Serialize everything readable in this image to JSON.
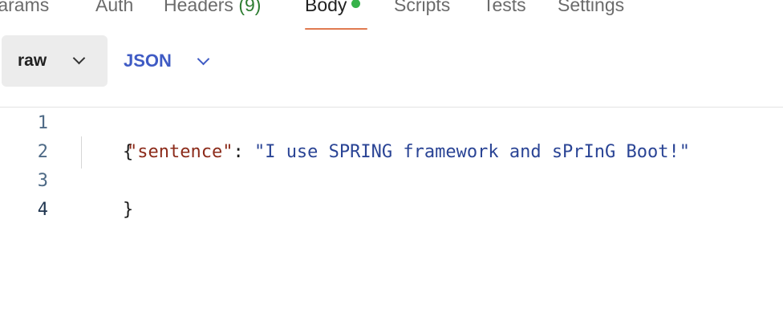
{
  "tabs": [
    {
      "label": "Params"
    },
    {
      "label": "Auth"
    },
    {
      "label": "Headers",
      "count": "(9)"
    },
    {
      "label": "Body"
    },
    {
      "label": "Scripts"
    },
    {
      "label": "Tests"
    },
    {
      "label": "Settings"
    }
  ],
  "active_tab": "Body",
  "toolbar": {
    "body_type": "raw",
    "format": "JSON"
  },
  "editor": {
    "line_numbers": [
      "1",
      "2",
      "3",
      "4"
    ],
    "lines": {
      "open_brace": "{",
      "key": "\"sentence\"",
      "colon": ": ",
      "value": "\"I use SPRING framework and sPrInG Boot!\"",
      "close_brace": "}"
    }
  },
  "colors": {
    "active_underline": "#e07a50",
    "status_dot": "#36b24a",
    "format_accent": "#3f5bc4",
    "json_key": "#8c2b1a",
    "json_string": "#2a4495"
  }
}
